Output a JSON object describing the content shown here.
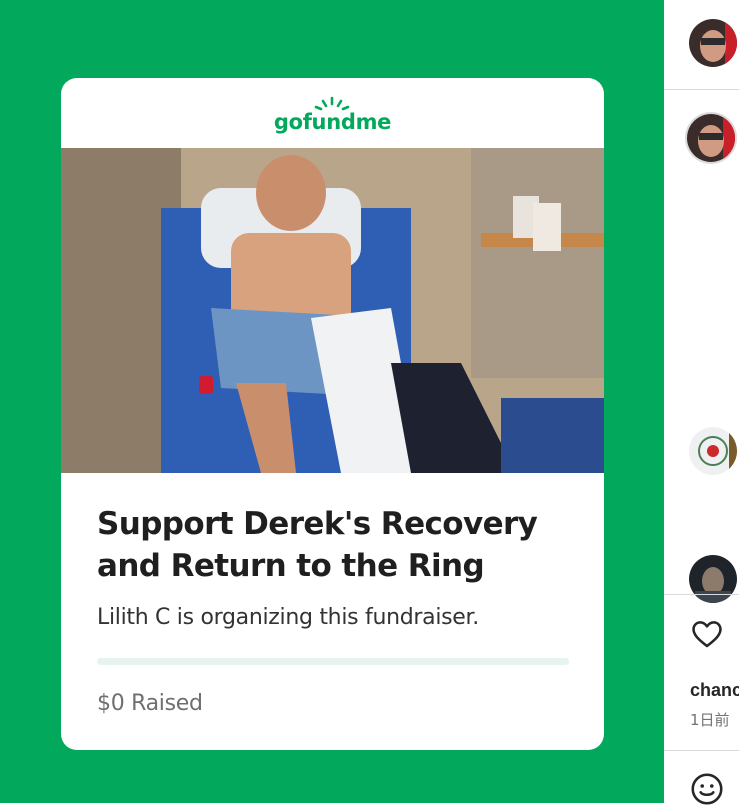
{
  "post": {
    "background_color": "#02a95c",
    "card": {
      "logo_text": "gofundme",
      "photo_subject": "hospital-bed-photo",
      "title": "Support Derek's Recovery and Return to the Ring",
      "organizer_line": "Lilith C is organizing this fundraiser.",
      "progress_fraction": 0,
      "raised_text": "$0 Raised"
    }
  },
  "sidebar": {
    "author_avatar": "profile-avatar",
    "caption_avatar": "profile-avatar",
    "commenter_avatars": [
      "comment-avatar",
      "comment-avatar"
    ],
    "like_icon": "heart-icon",
    "likes_user_partial": "chanc",
    "timestamp": "1日前",
    "emoji_icon": "smiley-icon"
  }
}
